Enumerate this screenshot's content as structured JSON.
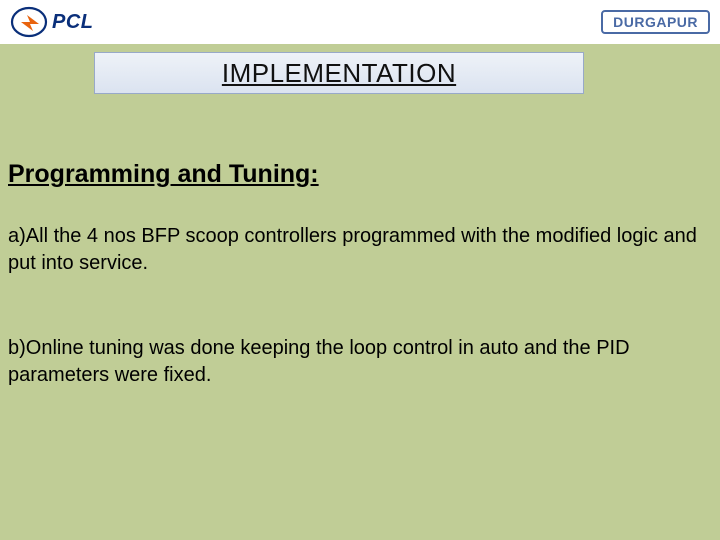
{
  "header": {
    "logo_left_text": "PCL",
    "logo_right_text": "DURGAPUR"
  },
  "title": "IMPLEMENTATION",
  "section_heading": "Programming and Tuning:",
  "paragraphs": {
    "a": "a)All the 4 nos BFP scoop controllers programmed with the modified logic and put into service.",
    "b": "b)Online tuning was done keeping the loop control in auto and the PID parameters were fixed."
  }
}
